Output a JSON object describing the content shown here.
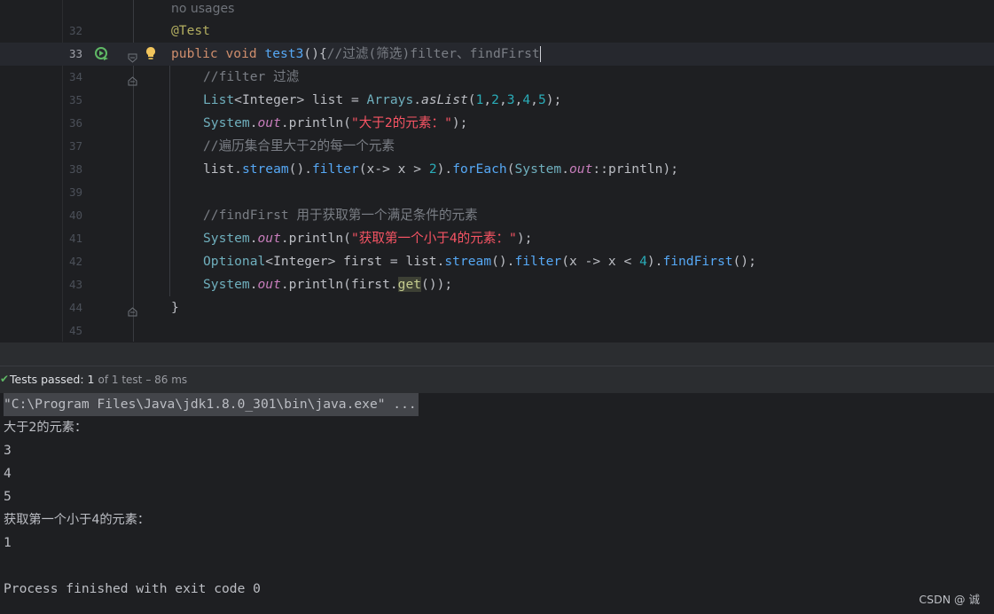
{
  "editor": {
    "usage_hint": "no usages",
    "line_numbers": [
      "32",
      "33",
      "34",
      "35",
      "36",
      "37",
      "38",
      "39",
      "40",
      "41",
      "42",
      "43",
      "44",
      "45"
    ],
    "lines": {
      "l32": {
        "annotation": "@Test"
      },
      "l33": {
        "kw1": "public",
        "kw2": "void",
        "method": "test3",
        "punct": "(){",
        "comment": "//过滤(筛选)filter、findFirst"
      },
      "l34": {
        "comment": "//filter 过滤"
      },
      "l35": {
        "type": "List",
        "generic": "<Integer>",
        "var": " list = ",
        "cls": "Arrays",
        "dot": ".",
        "method": "asList",
        "open": "(",
        "n1": "1",
        "n2": "2",
        "n3": "3",
        "n4": "4",
        "n5": "5",
        "close": ");"
      },
      "l36": {
        "cls": "System",
        "dot": ".",
        "field": "out",
        "call": ".println(",
        "str": "\"大于2的元素：\"",
        "close": ");"
      },
      "l37": {
        "comment": "//遍历集合里大于2的每一个元素"
      },
      "l38": {
        "pre": "list.",
        "m1": "stream",
        "mid1": "().",
        "m2": "filter",
        "mid2": "(x-> x > ",
        "num": "2",
        "mid3": ").",
        "m3": "forEach",
        "mid4": "(",
        "cls": "System",
        "dot": ".",
        "field": "out",
        "tail": "::println);"
      },
      "l40": {
        "comment": "//findFirst 用于获取第一个满足条件的元素"
      },
      "l41": {
        "cls": "System",
        "dot": ".",
        "field": "out",
        "call": ".println(",
        "str": "\"获取第一个小于4的元素：\"",
        "close": ");"
      },
      "l42": {
        "type": "Optional",
        "generic": "<Integer>",
        "pre": " first = list.",
        "m1": "stream",
        "mid1": "().",
        "m2": "filter",
        "mid2": "(x -> x < ",
        "num": "4",
        "mid3": ").",
        "m3": "findFirst",
        "close": "();"
      },
      "l43": {
        "cls": "System",
        "dot": ".",
        "field": "out",
        "call": ".println(first.",
        "get": "get",
        "close": "());"
      },
      "l44": {
        "brace": "}"
      }
    }
  },
  "test_status": {
    "check_icon": "check-icon",
    "label": "Tests passed:",
    "count": "1",
    "of": "of 1 test",
    "duration": "– 86 ms"
  },
  "console": {
    "command": "\"C:\\Program Files\\Java\\jdk1.8.0_301\\bin\\java.exe\" ...",
    "output": [
      "大于2的元素：",
      "3",
      "4",
      "5",
      "获取第一个小于4的元素：",
      "1"
    ],
    "exit_message": "Process finished with exit code 0"
  },
  "watermark": "CSDN @ 诚",
  "colors": {
    "editor_bg": "#1e1f22",
    "keyword": "#cf8e6d",
    "annotation": "#b3ae60",
    "method": "#56a8f5",
    "comment": "#7a7e85",
    "number": "#2aacb8",
    "string": "#6aab73",
    "pass_green": "#5fb865"
  }
}
